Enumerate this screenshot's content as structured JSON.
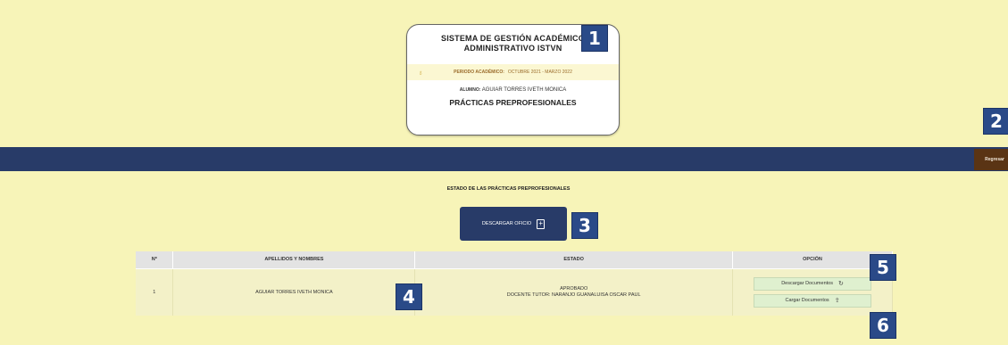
{
  "header": {
    "system_title": "SISTEMA DE GESTIÓN ACADÉMICO ADMINISTRATIVO ISTVN",
    "periodo_label": "PERIODO ACADÉMICO:",
    "periodo_value": "OCTUBRE 2021 - MARZO 2022",
    "alumno_label": "ALUMNO:",
    "alumno_value": "AGUIAR TORRES IVETH MONICA",
    "section_title": "PRÁCTICAS PREPROFESIONALES"
  },
  "nav": {
    "regresar_label": "Regresar"
  },
  "estado": {
    "title": "ESTADO DE LAS PRÁCTICAS PREPROFESIONALES",
    "descargar_oficio_label": "DESCARGAR OFICIO"
  },
  "table": {
    "headers": [
      "Nº",
      "APELLIDOS Y NOMBRES",
      "ESTADO",
      "OPCIÓN"
    ],
    "rows": [
      {
        "num": "1",
        "nombre": "AGUIAR TORRES IVETH MONICA",
        "estado_line1": "APROBADO",
        "estado_line2": "DOCENTE TUTOR: NARANJO GUANALUISA OSCAR PAUL",
        "btn_descargar": "Descargar Documentos",
        "btn_cargar": "Cargar Documentos"
      }
    ]
  },
  "markers": [
    "1",
    "2",
    "3",
    "4",
    "5",
    "6"
  ],
  "colors": {
    "background": "#f7f4b8",
    "navy": "#283b68",
    "regresar": "#5a3414",
    "marker": "#2a4a88",
    "option_button": "#dff0cf"
  },
  "icons": {
    "periodo": "lightbulb-icon",
    "descargar_oficio": "document-download-icon",
    "descargar_documentos": "refresh-icon",
    "cargar_documentos": "upload-icon"
  }
}
